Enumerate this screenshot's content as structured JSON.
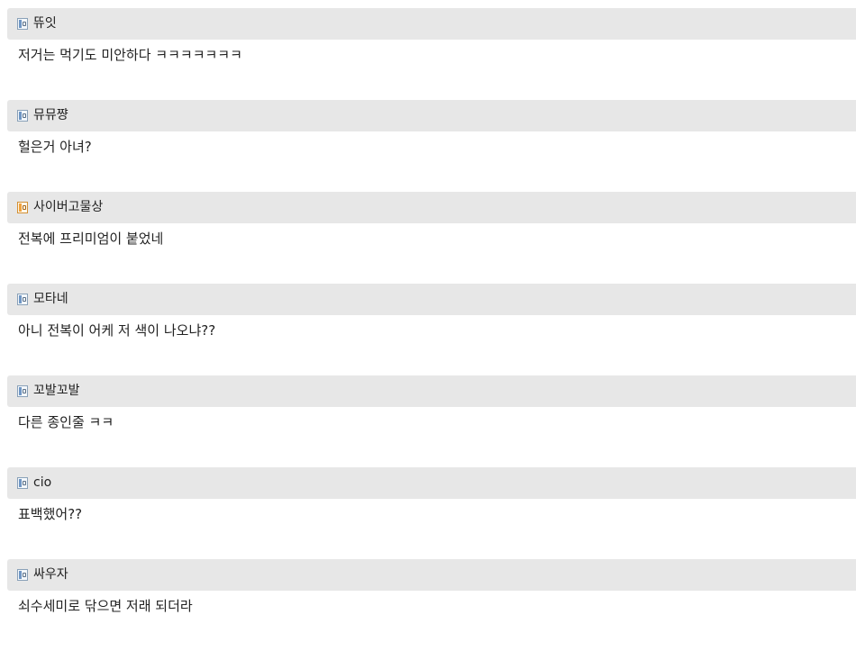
{
  "comments": [
    {
      "author": "뜌잇",
      "level_icon": "level-badge-blue-icon",
      "text": "저거는 먹기도 미안하다 ㅋㅋㅋㅋㅋㅋㅋ"
    },
    {
      "author": "뮤뮤쨩",
      "level_icon": "level-badge-blue-icon",
      "text": "헐은거 아녀?"
    },
    {
      "author": "사이버고물상",
      "level_icon": "level-badge-orange-icon",
      "text": "전복에 프리미엄이 붙었네"
    },
    {
      "author": "모타네",
      "level_icon": "level-badge-blue-icon",
      "text": "아니 전복이 어케 저 색이 나오냐??"
    },
    {
      "author": "꼬발꼬발",
      "level_icon": "level-badge-blue-icon",
      "text": "다른 종인줄 ㅋㅋ"
    },
    {
      "author": "cio",
      "level_icon": "level-badge-blue-icon",
      "text": "표백했어??"
    },
    {
      "author": "싸우자",
      "level_icon": "level-badge-blue-icon",
      "text": "쇠수세미로 닦으면 저래 되더라"
    }
  ]
}
